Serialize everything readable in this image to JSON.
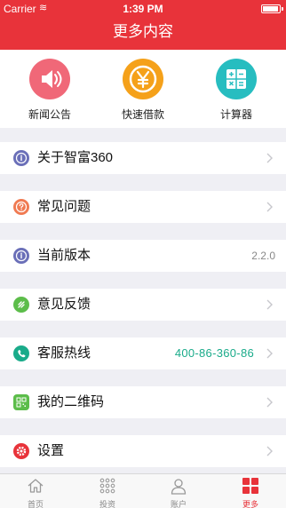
{
  "status_bar": {
    "carrier": "Carrier",
    "time": "1:39 PM"
  },
  "header": {
    "title": "更多内容"
  },
  "quick_actions": [
    {
      "label": "新闻公告",
      "icon": "speaker-icon",
      "color": "#f06878"
    },
    {
      "label": "快速借款",
      "icon": "yen-icon",
      "color": "#f5a11a"
    },
    {
      "label": "计算器",
      "icon": "calculator-icon",
      "color": "#27bdc0"
    }
  ],
  "menu": [
    {
      "label": "关于智富360",
      "icon": "info-icon",
      "icon_color": "#6a6fb8",
      "value": ""
    },
    {
      "label": "常见问题",
      "icon": "question-icon",
      "icon_color": "#f07a52",
      "value": ""
    },
    {
      "label": "当前版本",
      "icon": "info-icon",
      "icon_color": "#6a6fb8",
      "value": "2.2.0"
    },
    {
      "label": "意见反馈",
      "icon": "feedback-icon",
      "icon_color": "#5cbd4a",
      "value": ""
    },
    {
      "label": "客服热线",
      "icon": "phone-icon",
      "icon_color": "#1aab8a",
      "value": "400-86-360-86"
    },
    {
      "label": "我的二维码",
      "icon": "qr-code-icon",
      "icon_color": "#5cbd4a",
      "value": ""
    },
    {
      "label": "设置",
      "icon": "gear-icon",
      "icon_color": "#e8333a",
      "value": ""
    }
  ],
  "tabs": [
    {
      "label": "首页",
      "icon": "home-icon"
    },
    {
      "label": "投资",
      "icon": "grid-dots-icon"
    },
    {
      "label": "账户",
      "icon": "user-icon"
    },
    {
      "label": "更多",
      "icon": "more-grid-icon",
      "active": true
    }
  ],
  "colors": {
    "brand_red": "#e8333a",
    "hotline_green": "#1aab8a"
  }
}
